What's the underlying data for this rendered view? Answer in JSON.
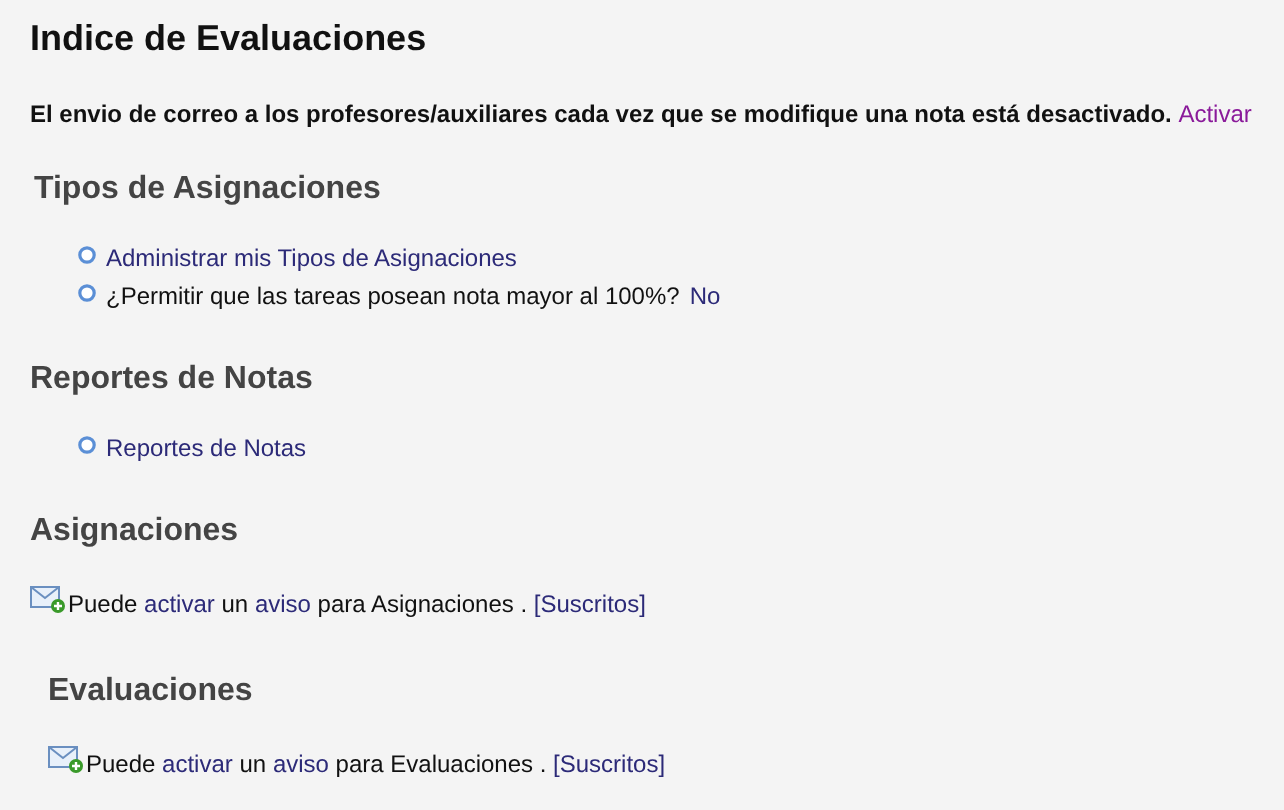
{
  "title": "Indice de Evaluaciones",
  "mail_notice": {
    "text": "El envio de correo a los profesores/auxiliares cada vez que se modifique una nota está desactivado.",
    "link": "Activar"
  },
  "sections": [
    {
      "heading": "Tipos de Asignaciones",
      "items": [
        {
          "parts": [
            {
              "text": "Administrar mis Tipos de Asignaciones",
              "link": true
            }
          ]
        },
        {
          "parts": [
            {
              "text": "¿Permitir que las tareas posean nota mayor al 100%?",
              "link": false
            },
            {
              "text": "No",
              "link": true
            }
          ]
        }
      ]
    },
    {
      "heading": "Reportes de Notas",
      "items": [
        {
          "parts": [
            {
              "text": "Reportes de Notas",
              "link": true
            }
          ]
        }
      ]
    }
  ],
  "subscriptions": [
    {
      "heading": "Asignaciones",
      "indented": false,
      "parts": [
        {
          "text": "Puede",
          "link": false
        },
        {
          "text": "activar",
          "link": true
        },
        {
          "text": "un",
          "link": false
        },
        {
          "text": "aviso",
          "link": true
        },
        {
          "text": "para Asignaciones .",
          "link": false
        },
        {
          "text": "[Suscritos]",
          "link": true
        }
      ]
    },
    {
      "heading": "Evaluaciones",
      "indented": true,
      "parts": [
        {
          "text": "Puede",
          "link": false
        },
        {
          "text": "activar",
          "link": true
        },
        {
          "text": "un",
          "link": false
        },
        {
          "text": "aviso",
          "link": true
        },
        {
          "text": "para Evaluaciones .",
          "link": false
        },
        {
          "text": "[Suscritos]",
          "link": true
        }
      ]
    }
  ]
}
